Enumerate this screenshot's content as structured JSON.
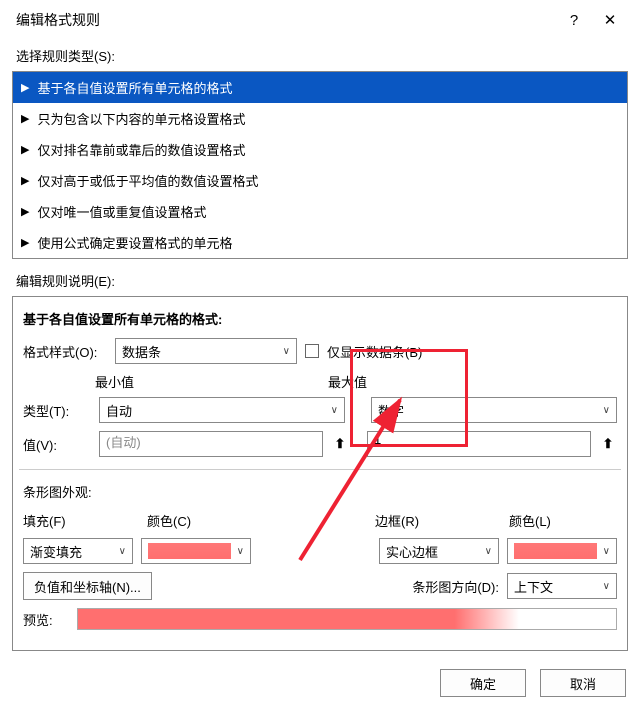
{
  "dialog": {
    "title": "编辑格式规则",
    "help": "?",
    "close": "✕"
  },
  "ruleTypeLabel": "选择规则类型(S):",
  "ruleTypes": [
    "基于各自值设置所有单元格的格式",
    "只为包含以下内容的单元格设置格式",
    "仅对排名靠前或靠后的数值设置格式",
    "仅对高于或低于平均值的数值设置格式",
    "仅对唯一值或重复值设置格式",
    "使用公式确定要设置格式的单元格"
  ],
  "editLabel": "编辑规则说明(E):",
  "editHeader": "基于各自值设置所有单元格的格式:",
  "formatStyle": {
    "label": "格式样式(O):",
    "value": "数据条"
  },
  "barOnly": {
    "label": "仅显示数据条(B)"
  },
  "minmax": {
    "minLabel": "最小值",
    "maxLabel": "最大值",
    "typeLabel": "类型(T):",
    "minType": "自动",
    "maxType": "数字",
    "valueLabel": "值(V):",
    "minValue": "(自动)",
    "maxValue": "1",
    "upIcon": "⬆"
  },
  "appearance": {
    "header": "条形图外观:",
    "fillLabel": "填充(F)",
    "fillValue": "渐变填充",
    "colorLabel": "颜色(C)",
    "borderLabel": "边框(R)",
    "borderValue": "实心边框",
    "colorLabel2": "颜色(L)"
  },
  "negAxis": {
    "btn": "负值和坐标轴(N)...",
    "dirLabel": "条形图方向(D):",
    "dirValue": "上下文"
  },
  "preview": {
    "label": "预览:"
  },
  "footer": {
    "ok": "确定",
    "cancel": "取消"
  }
}
